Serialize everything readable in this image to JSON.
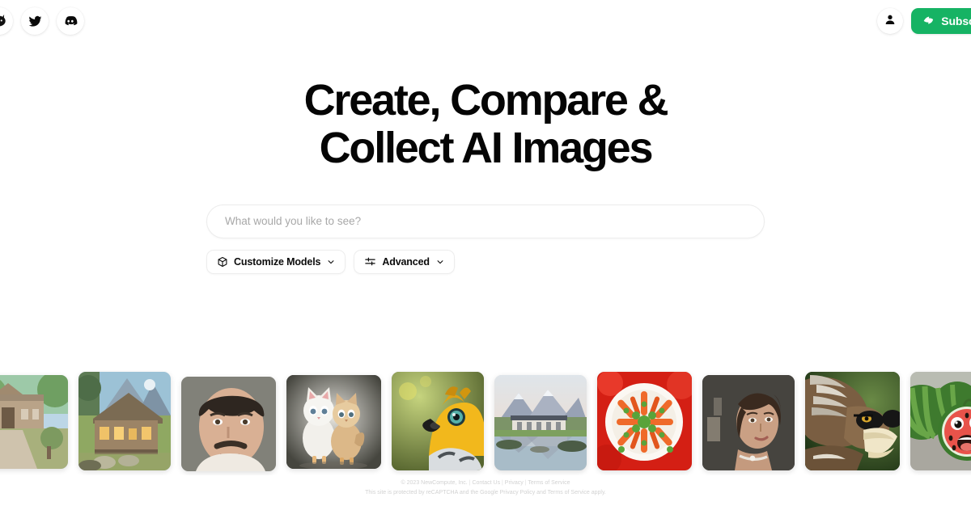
{
  "topbar": {
    "social": [
      {
        "name": "cat-logo",
        "icon": "cat-icon",
        "label": "NewCompute"
      },
      {
        "name": "twitter",
        "icon": "twitter-icon",
        "label": "Twitter"
      },
      {
        "name": "discord",
        "icon": "discord-icon",
        "label": "Discord"
      }
    ],
    "account_icon": "person-icon",
    "subscribe_label": "Subscribe",
    "subscribe_icon": "boost-icon",
    "subscribe_color": "#16b364"
  },
  "hero": {
    "headline_line1": "Create, Compare &",
    "headline_line2": "Collect AI Images",
    "search": {
      "value": "",
      "placeholder": "What would you like to see?"
    },
    "options": [
      {
        "label": "Customize Models",
        "icon": "cube-icon",
        "chevron": "⌄"
      },
      {
        "label": "Advanced",
        "icon": "sliders-icon",
        "chevron": "⌄"
      }
    ]
  },
  "gallery": {
    "items": [
      {
        "alt": "ornate stone mansion with garden path",
        "theme": "mansion"
      },
      {
        "alt": "wooden alpine cabin in mountains",
        "theme": "cabin"
      },
      {
        "alt": "portrait of a man with mustache",
        "theme": "man-portrait"
      },
      {
        "alt": "two kittens and a chick",
        "theme": "kittens"
      },
      {
        "alt": "yellow bird of prey close-up",
        "theme": "yellow-bird"
      },
      {
        "alt": "modern lakeside house with mountains",
        "theme": "lake-house"
      },
      {
        "alt": "plate of carrots with herbs on red",
        "theme": "carrots"
      },
      {
        "alt": "portrait of a woman with wet hair",
        "theme": "woman-portrait"
      },
      {
        "alt": "eagle wearing sunglasses",
        "theme": "eagle-glasses"
      },
      {
        "alt": "cartoon watermelon with a face",
        "theme": "watermelon"
      }
    ]
  },
  "footer": {
    "copyright": "© 2023 NewCompute, Inc.",
    "links": [
      "Contact Us",
      "Privacy",
      "Terms of Service"
    ],
    "separator": " | ",
    "recaptcha": "This site is protected by reCAPTCHA and the Google Privacy Policy and Terms of Service apply."
  }
}
